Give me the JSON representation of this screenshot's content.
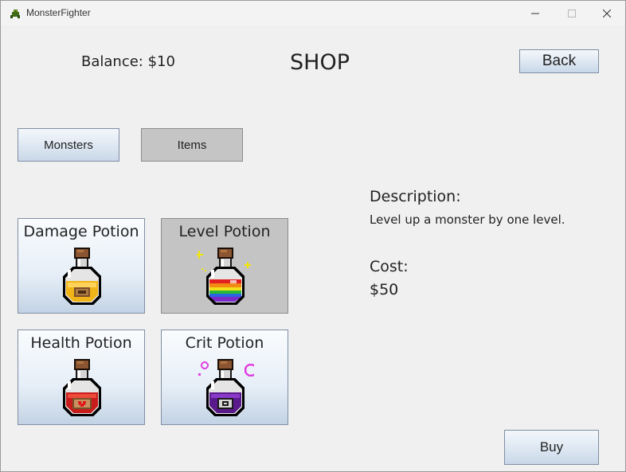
{
  "window": {
    "title": "MonsterFighter",
    "icon": "monster-icon"
  },
  "header": {
    "balance": "Balance: $10",
    "title": "SHOP",
    "back_label": "Back"
  },
  "tabs": [
    {
      "label": "Monsters",
      "selected": false
    },
    {
      "label": "Items",
      "selected": true
    }
  ],
  "items": [
    {
      "label": "Damage Potion",
      "icon": "damage-potion-icon",
      "color": "#f0b418",
      "selected": false
    },
    {
      "label": "Level Potion",
      "icon": "level-potion-icon",
      "color": "rainbow",
      "selected": true
    },
    {
      "label": "Health Potion",
      "icon": "health-potion-icon",
      "color": "#c81c1c",
      "selected": false
    },
    {
      "label": "Crit Potion",
      "icon": "crit-potion-icon",
      "color": "#5a1a8c",
      "selected": false
    }
  ],
  "details": {
    "description_heading": "Description:",
    "description": "Level up a monster by one level.",
    "cost_heading": "Cost:",
    "cost": "$50"
  },
  "buy_label": "Buy"
}
